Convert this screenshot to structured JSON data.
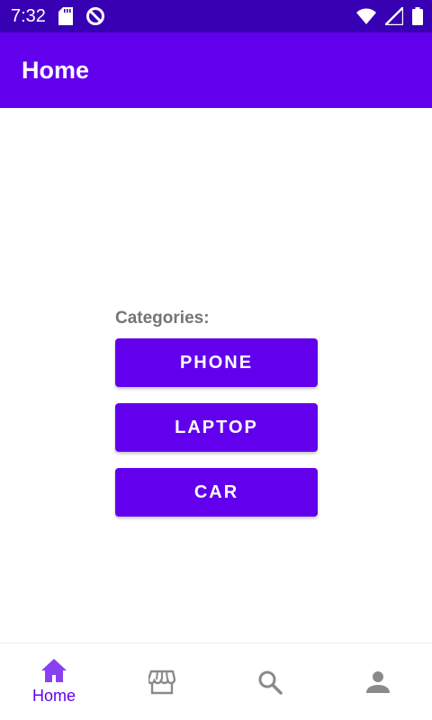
{
  "status_bar": {
    "time": "7:32",
    "left_icons": [
      "sd-card-icon",
      "data-saver-icon"
    ],
    "right_icons": [
      "wifi-icon",
      "signal-icon",
      "battery-icon"
    ]
  },
  "app_bar": {
    "title": "Home"
  },
  "main": {
    "categories_label": "Categories:",
    "buttons": [
      {
        "label": "PHONE"
      },
      {
        "label": "LAPTOP"
      },
      {
        "label": "CAR"
      }
    ]
  },
  "bottom_nav": {
    "items": [
      {
        "icon": "home-icon",
        "label": "Home",
        "selected": true
      },
      {
        "icon": "store-icon",
        "label": "",
        "selected": false
      },
      {
        "icon": "search-icon",
        "label": "",
        "selected": false
      },
      {
        "icon": "person-icon",
        "label": "",
        "selected": false
      }
    ]
  },
  "colors": {
    "status_bar": "#3700b3",
    "primary": "#6200ee",
    "label_gray": "#757575",
    "nav_inactive": "#8a8a8a"
  }
}
